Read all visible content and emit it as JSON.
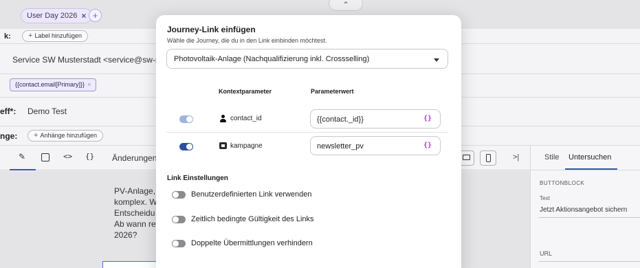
{
  "topbar": {
    "tag_label": "User Day 2026",
    "tag_close": "×",
    "add_symbol": "+",
    "handle_symbol": "⌃"
  },
  "rows": {
    "label_row_label": "k:",
    "add_label_button": "Label hinzufügen",
    "from_value": "Service SW Musterstadt <service@sw-m",
    "to_chip": "{{contact.email[Primary]}}",
    "to_chip_close": "×",
    "subject_label": "eff*:",
    "subject_value": "Demo Test",
    "attachments_label": "nge:",
    "add_attachments_button": "Anhänge hinzufügen"
  },
  "toolbar": {
    "edit_icon": "✎",
    "code_icon": "<>",
    "braces_icon": "{}",
    "changes_label": "Änderungen",
    "collapse_icon": ">|"
  },
  "canvas": {
    "lines": [
      "PV-Anlage,",
      "komplex. W",
      "Entscheidu",
      "Ab wann re",
      "2026?"
    ]
  },
  "right_panel": {
    "tab_styles": "Stile",
    "tab_inspect": "Untersuchen",
    "section_label": "BUTTONBLOCK",
    "text_label": "Text",
    "text_value": "Jetzt Aktionsangebot sichern",
    "url_label": "URL"
  },
  "modal": {
    "title": "Journey-Link einfügen",
    "subtitle": "Wähle die Journey, die du in den Link einbinden möchtest.",
    "journey_select_value": "Photovoltaik-Anlage (Nachqualifizierung inkl. Crossselling)",
    "col_context": "Kontextparameter",
    "col_value": "Parameterwert",
    "params": [
      {
        "name": "contact_id",
        "value": "{{contact._id}}",
        "braces": "{}"
      },
      {
        "name": "kampagne",
        "value": "newsletter_pv",
        "braces": "{}"
      }
    ],
    "settings_title": "Link Einstellungen",
    "options": [
      {
        "label": "Benutzerdefinierten Link verwenden"
      },
      {
        "label": "Zeitlich bedingte Gültigkeit des Links"
      },
      {
        "label": "Doppelte Übermittlungen verhindern"
      }
    ]
  },
  "colors": {
    "accent": "#2b4f9e",
    "brace_color": "#a23fb8"
  }
}
